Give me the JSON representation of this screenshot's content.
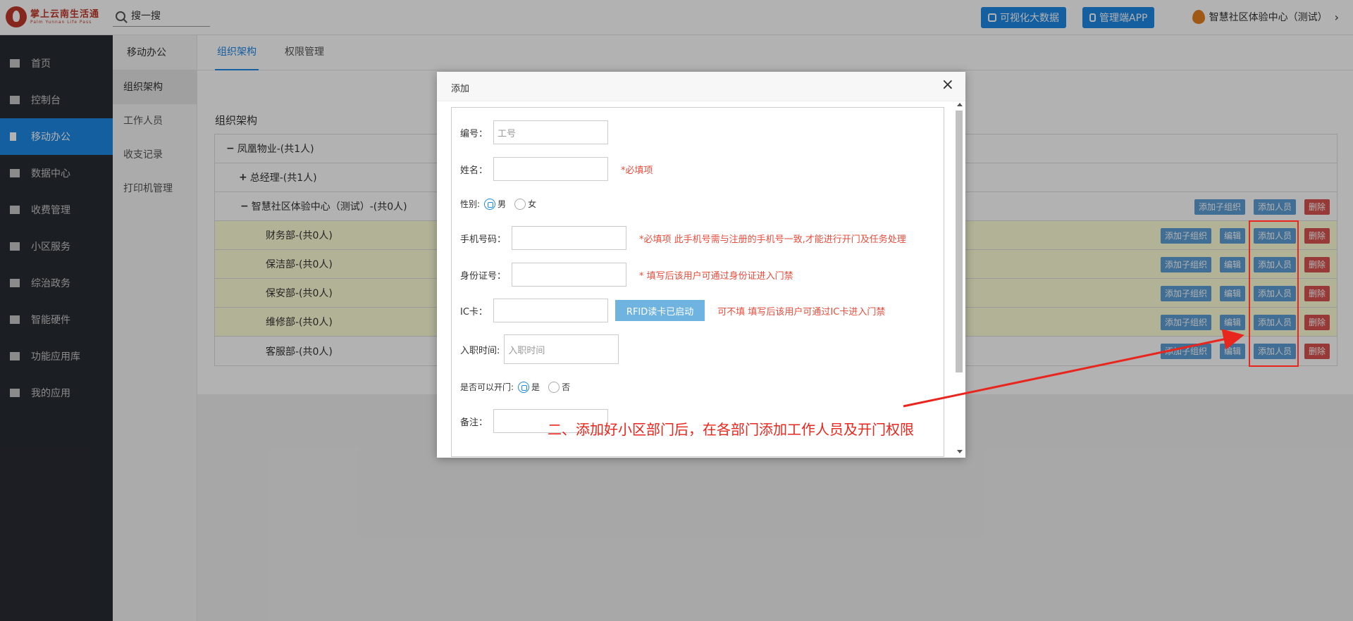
{
  "brand": {
    "title": "掌上云南生活通",
    "subtitle": "Palm Yunnan Life Pass"
  },
  "search": {
    "placeholder": "搜一搜"
  },
  "header": {
    "bigdata_label": "可视化大数据",
    "app_label": "管理端APP",
    "community_label": "智慧社区体验中心（测试）"
  },
  "sidebar": {
    "items": [
      {
        "label": "首页",
        "icon": "home-icon"
      },
      {
        "label": "控制台",
        "icon": "laptop-icon"
      },
      {
        "label": "移动办公",
        "icon": "mobile-icon",
        "active": true
      },
      {
        "label": "数据中心",
        "icon": "briefcase-icon"
      },
      {
        "label": "收费管理",
        "icon": "card-icon"
      },
      {
        "label": "小区服务",
        "icon": "home-icon"
      },
      {
        "label": "综治政务",
        "icon": "institution-icon"
      },
      {
        "label": "智能硬件",
        "icon": "wrench-icon"
      },
      {
        "label": "功能应用库",
        "icon": "cloud-download-icon"
      },
      {
        "label": "我的应用",
        "icon": "cloud-icon"
      }
    ]
  },
  "submenu": {
    "title": "移动办公",
    "items": [
      "组织架构",
      "工作人员",
      "收支记录",
      "打印机管理"
    ]
  },
  "tabs": [
    "组织架构",
    "权限管理"
  ],
  "section_title": "组织架构",
  "tree": {
    "root": "凤凰物业-(共1人)",
    "manager": "总经理-(共1人)",
    "center": "智慧社区体验中心（测试）-(共0人)",
    "depts": [
      "财务部-(共0人)",
      "保洁部-(共0人)",
      "保安部-(共0人)",
      "维修部-(共0人)",
      "客服部-(共0人)"
    ],
    "actions": {
      "add_child": "添加子组织",
      "edit": "编辑",
      "add_person": "添加人员",
      "delete": "删除"
    }
  },
  "dialog": {
    "title": "添加",
    "fields": {
      "id_label": "编号：",
      "id_placeholder": "工号",
      "name_label": "姓名：",
      "name_hint": "*必填项",
      "gender_label": "性别:",
      "gender_male": "男",
      "gender_female": "女",
      "phone_label": "手机号码：",
      "phone_hint": "*必填项 此手机号需与注册的手机号一致,才能进行开门及任务处理",
      "idcard_label": "身份证号：",
      "idcard_hint": "* 填写后该用户可通过身份证进入门禁",
      "ic_label": "IC卡：",
      "rfid_label": "RFID读卡已启动",
      "ic_hint": "可不填 填写后该用户可通过IC卡进入门禁",
      "hire_label": "入职时间:",
      "hire_placeholder": "入职时间",
      "door_label": "是否可以开门:",
      "door_yes": "是",
      "door_no": "否",
      "remark_label": "备注："
    }
  },
  "annotation": "二、添加好小区部门后，在各部门添加工作人员及开门权限",
  "colors": {
    "accent": "#1e88e5",
    "danger": "#d9534f",
    "annotation": "#e8261d"
  }
}
